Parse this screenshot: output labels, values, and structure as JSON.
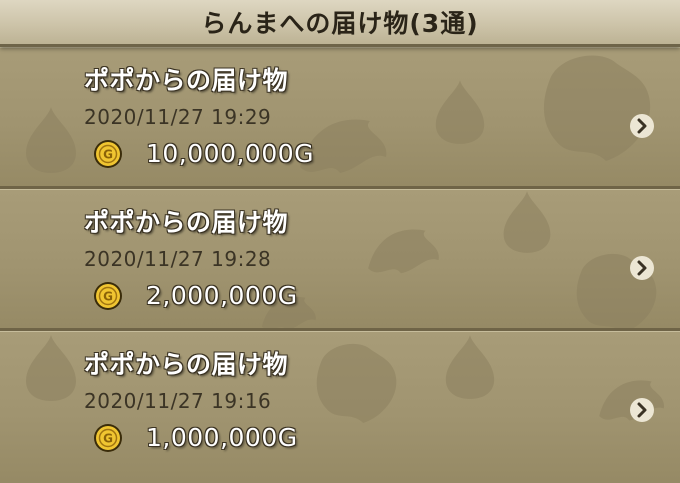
{
  "header": {
    "title": "らんまへの届け物(3通)"
  },
  "items": [
    {
      "sender": "ポポからの届け物",
      "date": "2020/11/27  19:29",
      "amount": "10,000,000G",
      "icon": "gold-coin-icon"
    },
    {
      "sender": "ポポからの届け物",
      "date": "2020/11/27  19:28",
      "amount": "2,000,000G",
      "icon": "gold-coin-icon"
    },
    {
      "sender": "ポポからの届け物",
      "date": "2020/11/27  19:16",
      "amount": "1,000,000G",
      "icon": "gold-coin-icon"
    }
  ],
  "colors": {
    "header_bg": "#d8d0b8",
    "panel_bg": "#a29672",
    "divider": "#6f6447",
    "text_white": "#ffffff",
    "text_dark": "#3b3425",
    "coin_gold": "#e8b820"
  }
}
